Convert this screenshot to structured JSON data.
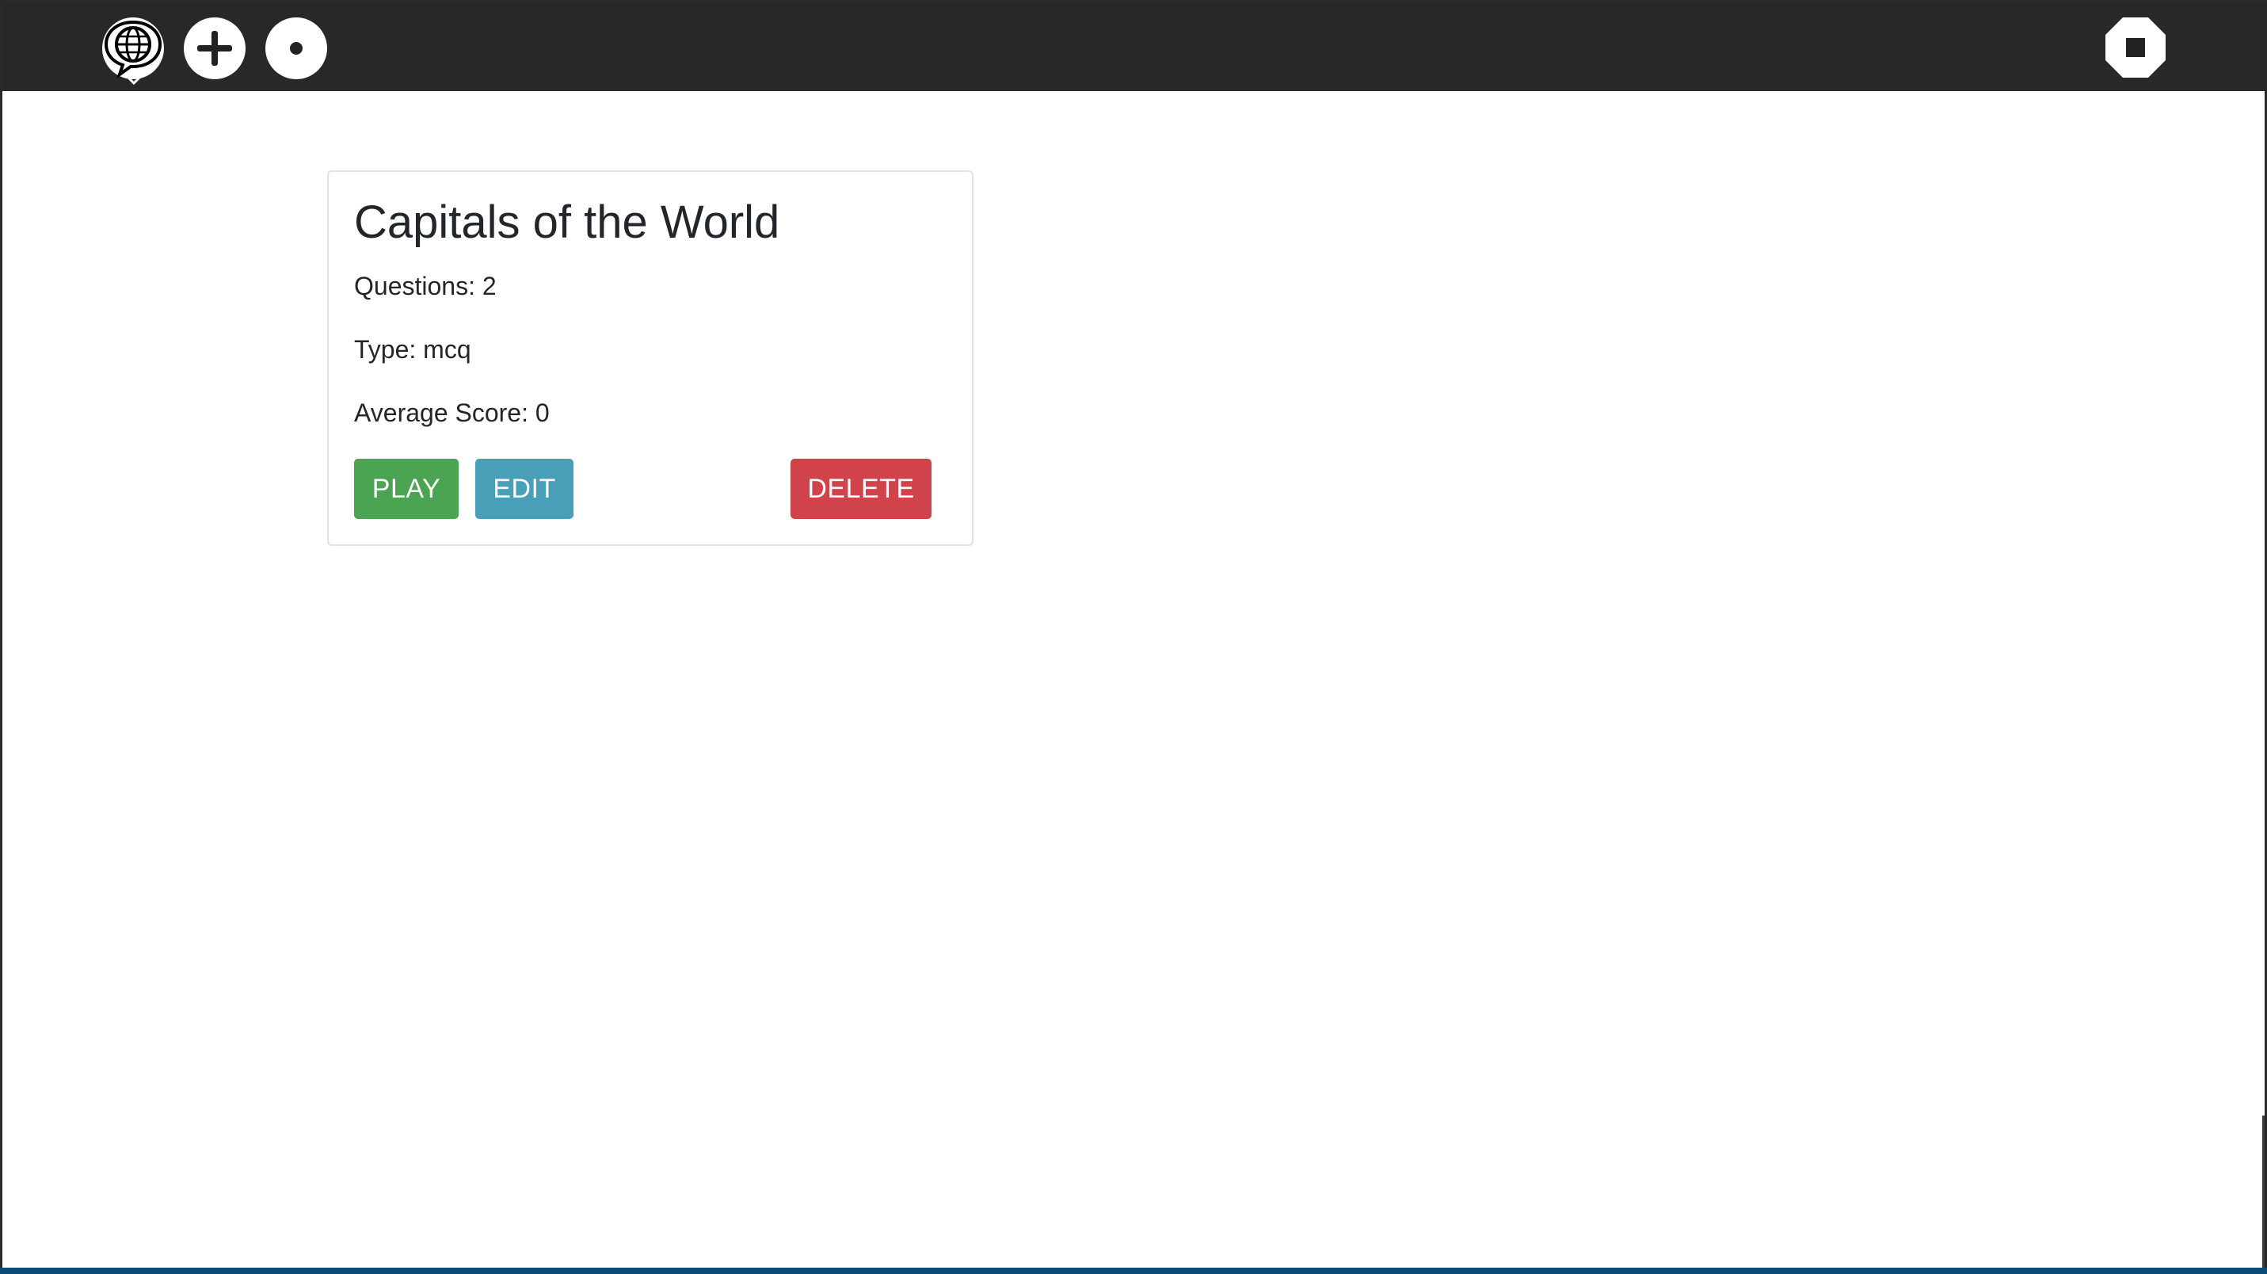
{
  "toolbar": {
    "icons": {
      "language": "globe-speech-bubble-icon",
      "add": "plus-icon",
      "record": "dot-icon",
      "stop": "stop-octagon-icon"
    }
  },
  "quiz_card": {
    "title": "Capitals of the World",
    "questions": "Questions: 2",
    "type": "Type: mcq",
    "average_score": "Average Score: 0",
    "buttons": {
      "play": "PLAY",
      "edit": "EDIT",
      "delete": "DELETE"
    }
  },
  "colors": {
    "toolbar_bg": "#282828",
    "play": "#4aa451",
    "edit": "#4a9fb8",
    "delete": "#d0434a"
  }
}
